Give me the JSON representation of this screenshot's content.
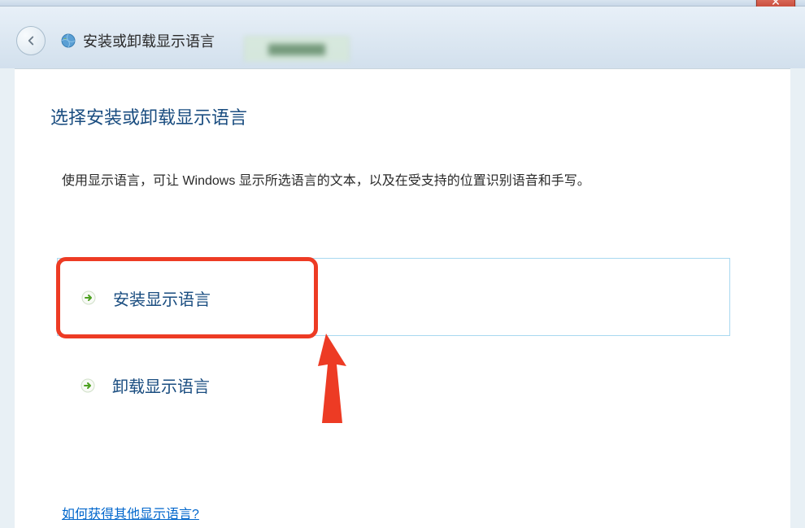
{
  "header": {
    "window_title": "安装或卸载显示语言",
    "close_label": "✕"
  },
  "content": {
    "page_title": "选择安装或卸载显示语言",
    "description": "使用显示语言，可让 Windows 显示所选语言的文本，以及在受支持的位置识别语音和手写。",
    "option_install": "安装显示语言",
    "option_uninstall": "卸载显示语言",
    "help_link": "如何获得其他显示语言?"
  }
}
